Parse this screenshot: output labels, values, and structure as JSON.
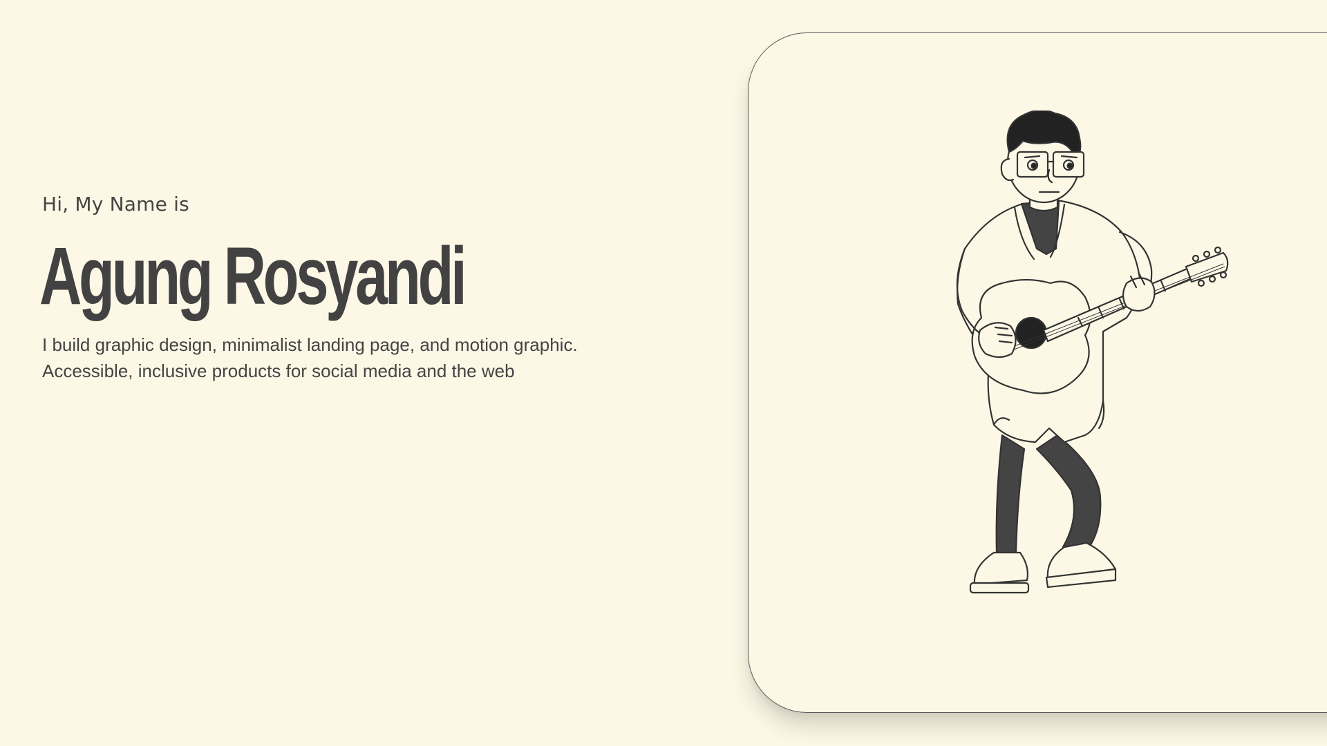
{
  "hero": {
    "greeting": "Hi, My Name is",
    "name": "Agung Rosyandi",
    "tagline_line1": "I build graphic design, minimalist landing page, and motion graphic.",
    "tagline_line2": "Accessible, inclusive products for social media and the web"
  },
  "illustration": {
    "icon": "guitarist-illustration"
  },
  "colors": {
    "background": "#fdf8e6",
    "text": "#444444",
    "outline": "#333333"
  }
}
